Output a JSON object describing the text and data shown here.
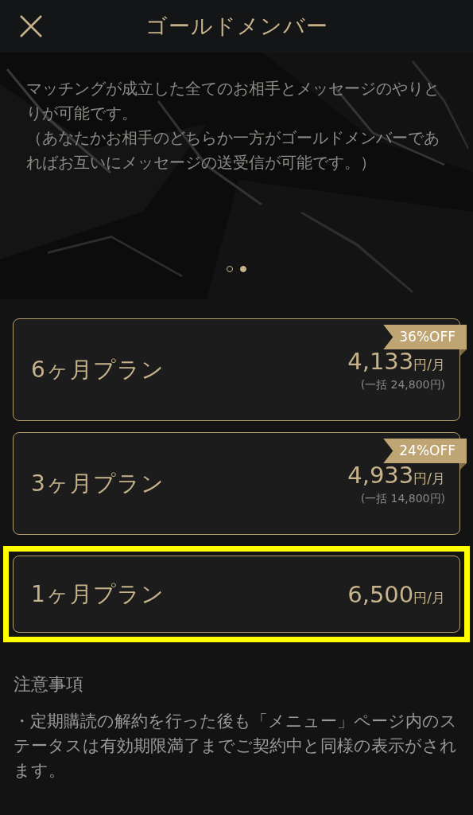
{
  "header": {
    "title": "ゴールドメンバー"
  },
  "hero": {
    "paragraphs": [
      "マッチングが成立した全てのお相手とメッセージのやりとりが可能です。",
      "（あなたかお相手のどちらか一方がゴールドメンバーであればお互いにメッセージの送受信が可能です。）"
    ],
    "dots": [
      {
        "selected": false
      },
      {
        "selected": true
      }
    ]
  },
  "plans": [
    {
      "name": "6ヶ月プラン",
      "amount": "4,133",
      "unit": "円/月",
      "bulk": "(一括 24,800円)",
      "badge": "36%OFF",
      "highlighted": false
    },
    {
      "name": "3ヶ月プラン",
      "amount": "4,933",
      "unit": "円/月",
      "bulk": "(一括 14,800円)",
      "badge": "24%OFF",
      "highlighted": false
    },
    {
      "name": "1ヶ月プラン",
      "amount": "6,500",
      "unit": "円/月",
      "highlighted": true
    }
  ],
  "notes": {
    "heading": "注意事項",
    "items": [
      "・定期購読の解約を行った後も「メニュー」ページ内のステータスは有効期限満了までご契約中と同様の表示がされます。"
    ]
  }
}
